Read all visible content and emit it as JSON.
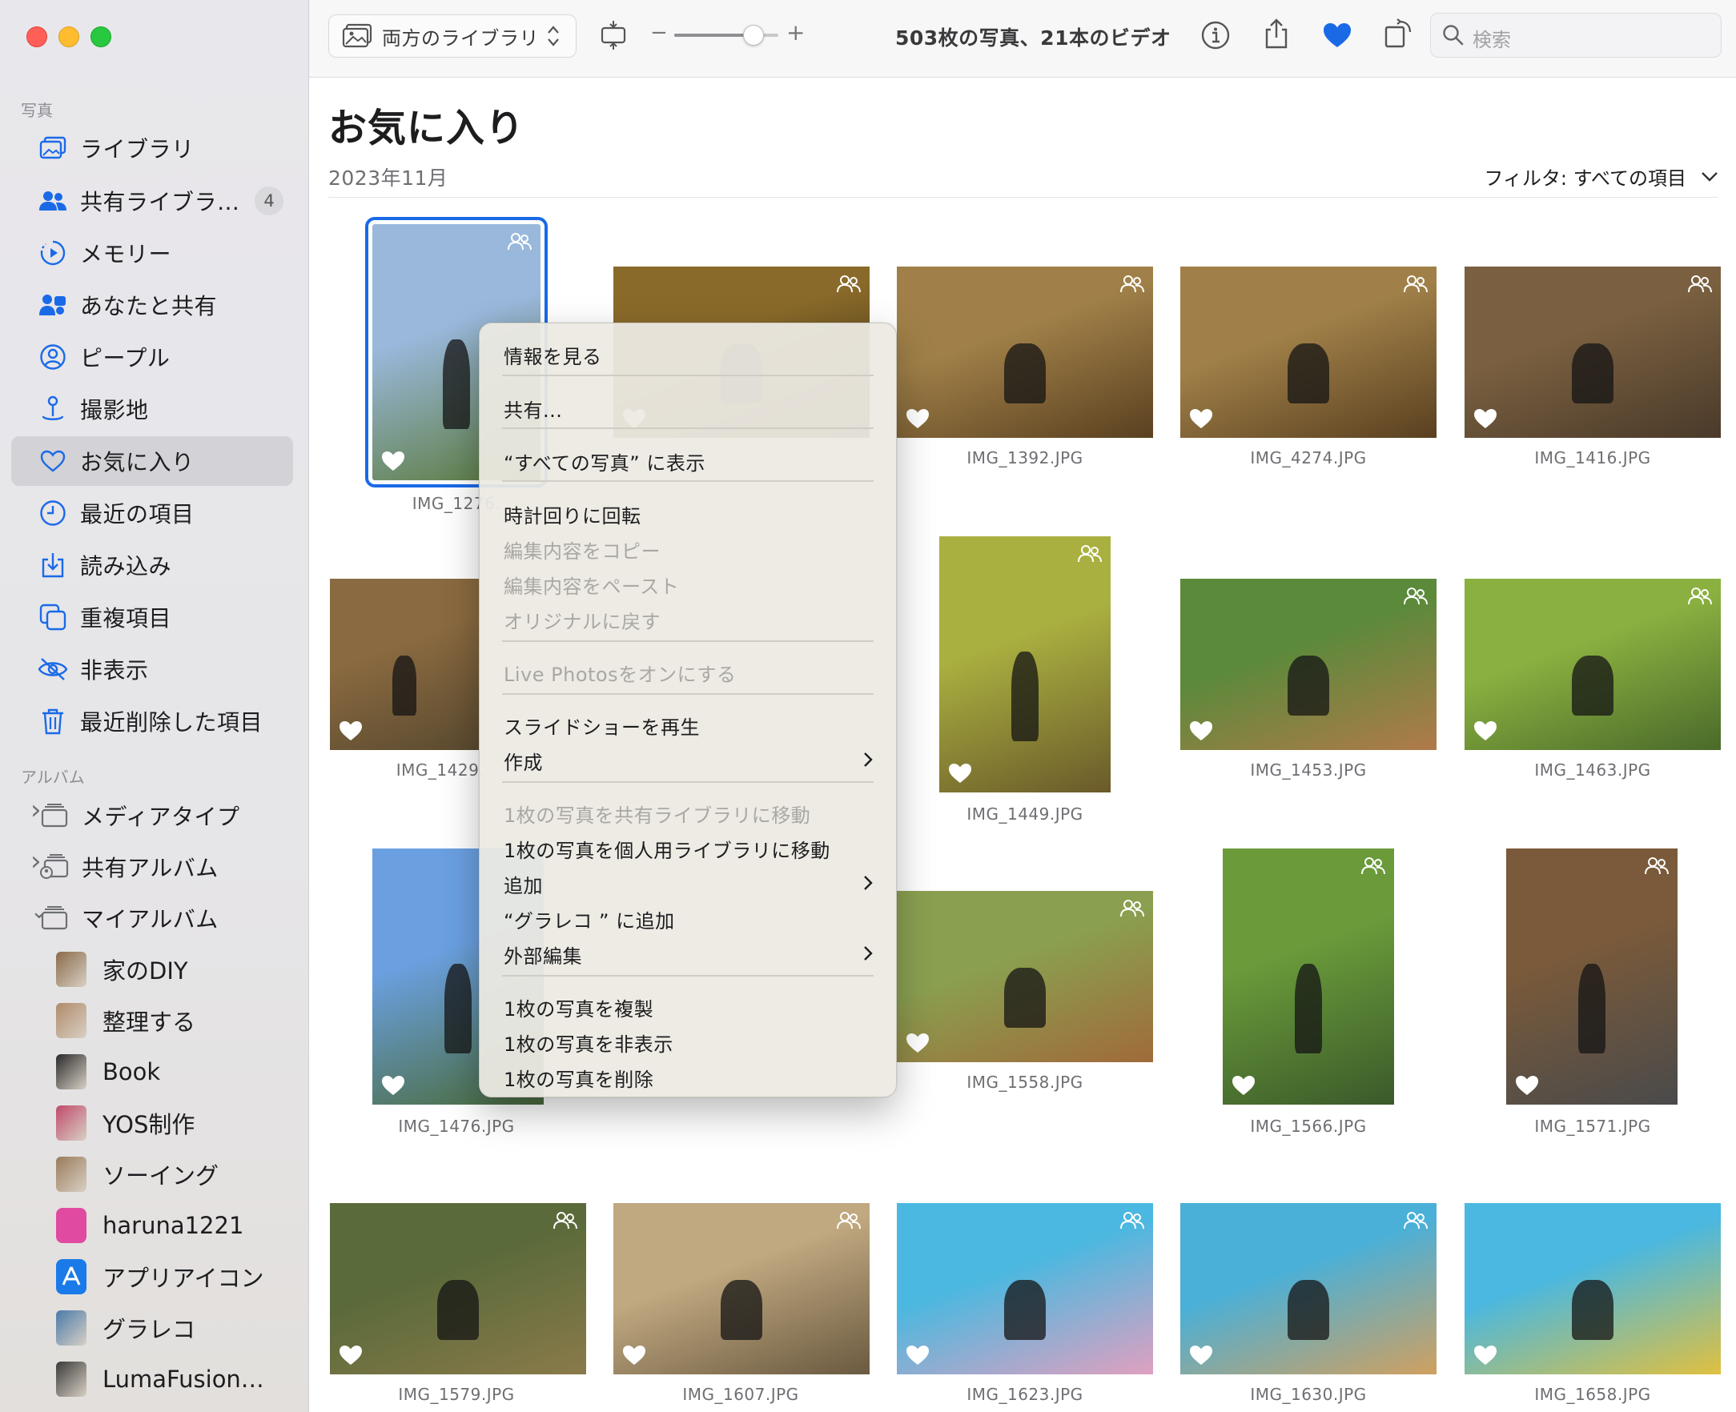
{
  "sidebar": {
    "section_photos": "写真",
    "items": [
      {
        "label": "ライブラリ",
        "icon": "library-icon"
      },
      {
        "label": "共有ライブラ…",
        "icon": "people-icon",
        "badge": "4"
      },
      {
        "label": "メモリー",
        "icon": "memories-icon"
      },
      {
        "label": "あなたと共有",
        "icon": "shared-with-you-icon"
      },
      {
        "label": "ピープル",
        "icon": "person-icon"
      },
      {
        "label": "撮影地",
        "icon": "places-icon"
      },
      {
        "label": "お気に入り",
        "icon": "heart-icon"
      },
      {
        "label": "最近の項目",
        "icon": "clock-icon"
      },
      {
        "label": "読み込み",
        "icon": "import-icon"
      },
      {
        "label": "重複項目",
        "icon": "duplicates-icon"
      },
      {
        "label": "非表示",
        "icon": "hidden-eye-icon"
      },
      {
        "label": "最近削除した項目",
        "icon": "trash-icon"
      }
    ],
    "section_albums": "アルバム",
    "folders": [
      {
        "label": "メディアタイプ",
        "chevron": "›"
      },
      {
        "label": "共有アルバム",
        "chevron": "›"
      },
      {
        "label": "マイアルバム",
        "chevron": "⌄"
      }
    ],
    "albums": [
      {
        "label": "家のDIY",
        "color": "#8a6a4a"
      },
      {
        "label": "整理する",
        "color": "#b08a6a"
      },
      {
        "label": "Book",
        "color": "#2a2a2a"
      },
      {
        "label": "YOS制作",
        "color": "#c04a6a"
      },
      {
        "label": "ソーイング",
        "color": "#9a7a5a"
      },
      {
        "label": "haruna1221",
        "color": "#e04aa0"
      },
      {
        "label": "アプリアイコン",
        "color": "#1a7ae8"
      },
      {
        "label": "グラレコ",
        "color": "#4a7aaa"
      },
      {
        "label": "LumaFusion…",
        "color": "#3a3a3a"
      }
    ]
  },
  "toolbar": {
    "library_selector": "両方のライブラリ",
    "zoom_minus": "−",
    "zoom_plus": "+",
    "zoom_level": 0.75,
    "count": "503枚の写真、21本のビデオ",
    "search_placeholder": "検索"
  },
  "main": {
    "title": "お気に入り",
    "date": "2023年11月",
    "filter": "フィルタ: すべての項目"
  },
  "photos": [
    {
      "name": "IMG_1276.JPG",
      "label": "IMG_1276.",
      "colors": [
        "#9ab8dc",
        "#5a7a3a"
      ],
      "shared": true,
      "selected": true
    },
    {
      "name": "",
      "label": "",
      "colors": [
        "#8a6a2a",
        "#4a3a1a"
      ],
      "shared": true
    },
    {
      "name": "IMG_1392.JPG",
      "label": "IMG_1392.JPG",
      "colors": [
        "#a08048",
        "#5a4020"
      ],
      "shared": true
    },
    {
      "name": "IMG_4274.JPG",
      "label": "IMG_4274.JPG",
      "colors": [
        "#a08048",
        "#5a4020"
      ],
      "shared": true
    },
    {
      "name": "IMG_1416.JPG",
      "label": "IMG_1416.JPG",
      "colors": [
        "#7a6040",
        "#4a3a2a"
      ],
      "shared": true
    },
    {
      "name": "IMG_1429.JPG",
      "label": "IMG_1429.",
      "colors": [
        "#8a6a40",
        "#5a4a30"
      ],
      "shared": false
    },
    {
      "name": "IMG_1449.JPG",
      "label": "IMG_1449.JPG",
      "colors": [
        "#aab040",
        "#6a5a2a"
      ],
      "shared": true
    },
    {
      "name": "IMG_1453.JPG",
      "label": "IMG_1453.JPG",
      "colors": [
        "#5a8a3a",
        "#b07a4a"
      ],
      "shared": true
    },
    {
      "name": "IMG_1463.JPG",
      "label": "IMG_1463.JPG",
      "colors": [
        "#8ab040",
        "#4a6a2a"
      ],
      "shared": true
    },
    {
      "name": "IMG_1476.JPG",
      "label": "IMG_1476.JPG",
      "colors": [
        "#6aa0e0",
        "#4a6a3a"
      ],
      "shared": false
    },
    {
      "name": "IMG_1558.JPG",
      "label": "IMG_1558.JPG",
      "colors": [
        "#8aa050",
        "#a06a3a"
      ],
      "shared": true
    },
    {
      "name": "IMG_1566.JPG",
      "label": "IMG_1566.JPG",
      "colors": [
        "#6a9a3a",
        "#3a5a2a"
      ],
      "shared": true
    },
    {
      "name": "IMG_1571.JPG",
      "label": "IMG_1571.JPG",
      "colors": [
        "#7a5a3a",
        "#4a4a4a"
      ],
      "shared": true
    },
    {
      "name": "IMG_1579.JPG",
      "label": "IMG_1579.JPG",
      "colors": [
        "#5a6a3a",
        "#8a7a4a"
      ],
      "shared": true
    },
    {
      "name": "IMG_1607.JPG",
      "label": "IMG_1607.JPG",
      "colors": [
        "#c0a880",
        "#6a5a40"
      ],
      "shared": true
    },
    {
      "name": "IMG_1623.JPG",
      "label": "IMG_1623.JPG",
      "colors": [
        "#4ab8e0",
        "#e0a0c0"
      ],
      "shared": true
    },
    {
      "name": "IMG_1630.JPG",
      "label": "IMG_1630.JPG",
      "colors": [
        "#4ab0d8",
        "#d0a060"
      ],
      "shared": true
    },
    {
      "name": "IMG_1658.JPG",
      "label": "IMG_1658.JPG",
      "colors": [
        "#4ab8e0",
        "#e0c040"
      ],
      "shared": false
    }
  ],
  "context_menu": {
    "items": [
      {
        "label": "情報を見る",
        "enabled": true
      },
      {
        "label": "共有...",
        "enabled": true
      },
      {
        "label": "“すべての写真” に表示",
        "enabled": true
      },
      {
        "label": "時計回りに回転",
        "enabled": true
      },
      {
        "label": "編集内容をコピー",
        "enabled": false
      },
      {
        "label": "編集内容をペースト",
        "enabled": false
      },
      {
        "label": "オリジナルに戻す",
        "enabled": false
      },
      {
        "label": "Live Photosをオンにする",
        "enabled": false
      },
      {
        "label": "スライドショーを再生",
        "enabled": true
      },
      {
        "label": "作成",
        "enabled": true,
        "submenu": true
      },
      {
        "label": "1枚の写真を共有ライブラリに移動",
        "enabled": false
      },
      {
        "label": "1枚の写真を個人用ライブラリに移動",
        "enabled": true
      },
      {
        "label": "追加",
        "enabled": true,
        "submenu": true
      },
      {
        "label": "“グラレコ ” に追加",
        "enabled": true
      },
      {
        "label": "外部編集",
        "enabled": true,
        "submenu": true
      },
      {
        "label": "1枚の写真を複製",
        "enabled": true
      },
      {
        "label": "1枚の写真を非表示",
        "enabled": true
      },
      {
        "label": "1枚の写真を削除",
        "enabled": true
      }
    ]
  }
}
